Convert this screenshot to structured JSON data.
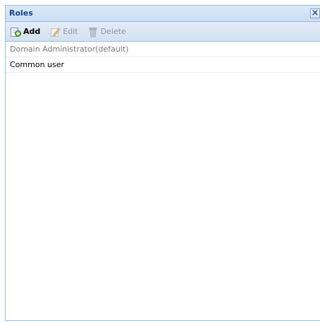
{
  "window": {
    "title": "Roles",
    "close_glyph": "×"
  },
  "toolbar": {
    "add_label": "Add",
    "edit_label": "Edit",
    "delete_label": "Delete"
  },
  "roles": [
    "Domain Administrator(default)",
    "Common user"
  ],
  "colors": {
    "title_text": "#15428b",
    "border": "#99bbe8"
  }
}
